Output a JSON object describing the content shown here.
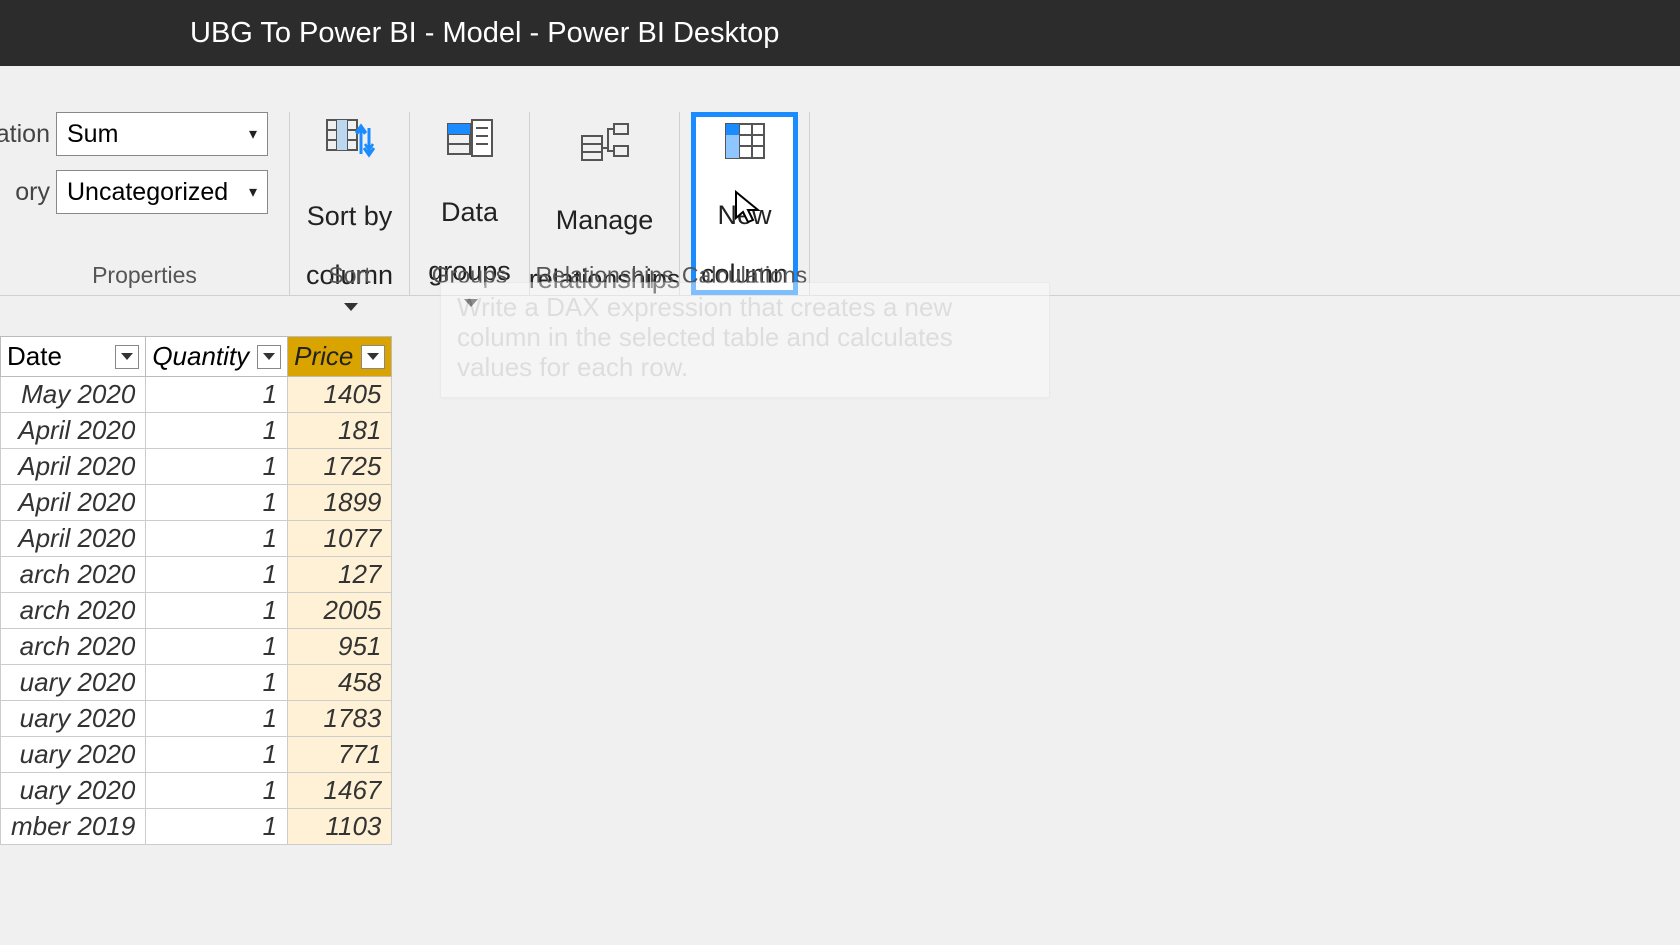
{
  "title": "UBG To Power BI - Model - Power BI Desktop",
  "properties": {
    "row1_label_suffix": "ation",
    "row1_value": "Sum",
    "row2_label_suffix": "ory",
    "row2_value": "Uncategorized",
    "group_label": "Properties"
  },
  "ribbon": {
    "sort": {
      "line1": "Sort by",
      "line2": "column",
      "group": "Sort"
    },
    "groups": {
      "line1": "Data",
      "line2": "groups",
      "group": "Groups"
    },
    "rel": {
      "line1": "Manage",
      "line2": "relationships",
      "group": "Relationships"
    },
    "calc": {
      "line1": "New",
      "line2": "column",
      "group": "Calculations"
    }
  },
  "tooltip": "Write a DAX expression that creates a new column in the selected table and calculates values for each row.",
  "table": {
    "headers": {
      "date": "Date",
      "qty": "Quantity",
      "price": "Price"
    },
    "rows": [
      {
        "date": "May 2020",
        "qty": "1",
        "price": "1405"
      },
      {
        "date": "April 2020",
        "qty": "1",
        "price": "181"
      },
      {
        "date": "April 2020",
        "qty": "1",
        "price": "1725"
      },
      {
        "date": "April 2020",
        "qty": "1",
        "price": "1899"
      },
      {
        "date": "April 2020",
        "qty": "1",
        "price": "1077"
      },
      {
        "date": "arch 2020",
        "qty": "1",
        "price": "127"
      },
      {
        "date": "arch 2020",
        "qty": "1",
        "price": "2005"
      },
      {
        "date": "arch 2020",
        "qty": "1",
        "price": "951"
      },
      {
        "date": "uary 2020",
        "qty": "1",
        "price": "458"
      },
      {
        "date": "uary 2020",
        "qty": "1",
        "price": "1783"
      },
      {
        "date": "uary 2020",
        "qty": "1",
        "price": "771"
      },
      {
        "date": "uary 2020",
        "qty": "1",
        "price": "1467"
      },
      {
        "date": "mber 2019",
        "qty": "1",
        "price": "1103"
      }
    ]
  }
}
